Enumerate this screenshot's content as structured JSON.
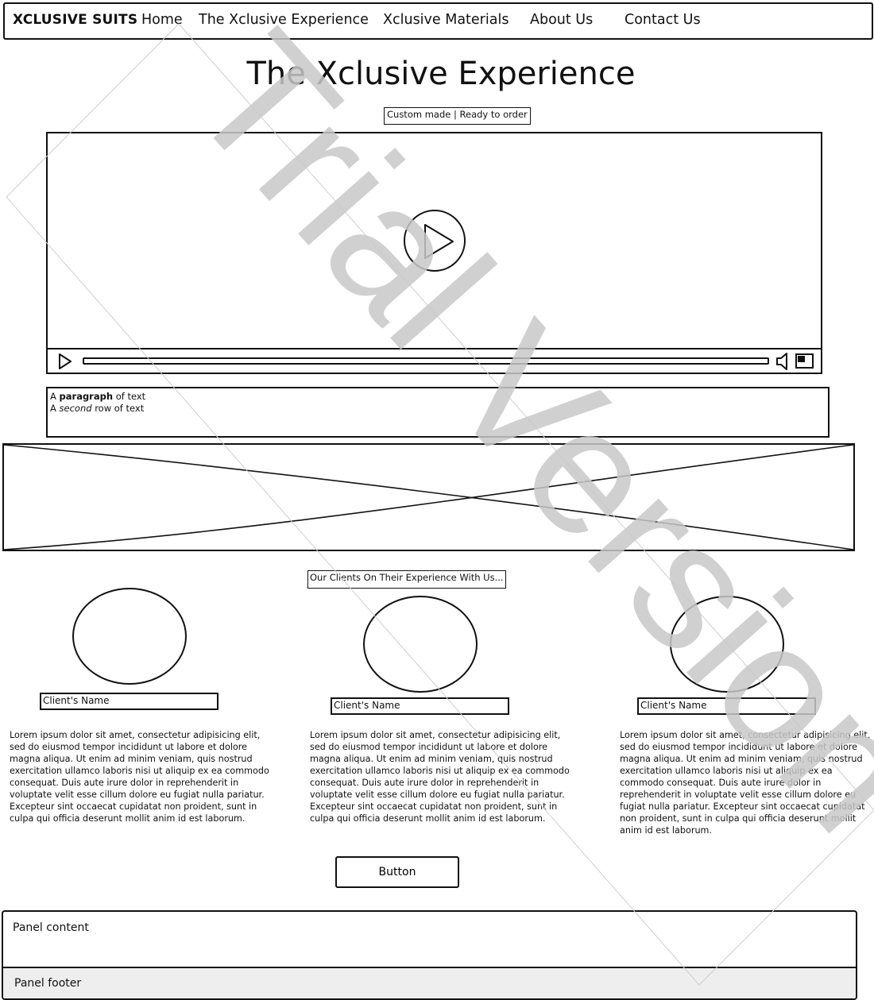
{
  "navbar": {
    "brand": "XCLUSIVE SUITS",
    "links": [
      "Home",
      "The Xclusive Experience",
      "Xclusive Materials",
      "About Us",
      "Contact Us"
    ]
  },
  "page": {
    "title": "The Xclusive Experience",
    "subtitle": "Custom made | Ready to order"
  },
  "video": {
    "play_icon": "play-icon",
    "control_icons": [
      "play-icon",
      "volume-icon",
      "fullscreen-icon"
    ]
  },
  "paragraph": {
    "line1_prefix": "A ",
    "line1_bold": "paragraph",
    "line1_suffix": " of text",
    "line2_prefix": "A ",
    "line2_italic": "second",
    "line2_suffix": " row of text"
  },
  "clients": {
    "heading": "Our Clients On Their Experience With Us...",
    "items": [
      {
        "name": "Client's Name",
        "text": "Lorem ipsum dolor sit amet, consectetur adipisicing elit, sed do eiusmod tempor incididunt ut labore et dolore magna aliqua. Ut enim ad minim veniam, quis nostrud exercitation ullamco laboris nisi ut aliquip ex ea commodo consequat. Duis aute irure dolor in reprehenderit in voluptate velit esse cillum dolore eu fugiat nulla pariatur. Excepteur sint occaecat cupidatat non proident, sunt in culpa qui officia deserunt mollit anim id est laborum."
      },
      {
        "name": "Client's Name",
        "text": "Lorem ipsum dolor sit amet, consectetur adipisicing elit, sed do eiusmod tempor incididunt ut labore et dolore magna aliqua. Ut enim ad minim veniam, quis nostrud exercitation ullamco laboris nisi ut aliquip ex ea commodo consequat. Duis aute irure dolor in reprehenderit in voluptate velit esse cillum dolore eu fugiat nulla pariatur. Excepteur sint occaecat cupidatat non proident, sunt in culpa qui officia deserunt mollit anim id est laborum."
      },
      {
        "name": "Client's Name",
        "text": "Lorem ipsum dolor sit amet, consectetur adipisicing elit, sed do eiusmod tempor incididunt ut labore et dolore magna aliqua. Ut enim ad minim veniam, quis nostrud exercitation ullamco laboris nisi ut aliquip ex ea commodo consequat. Duis aute irure dolor in reprehenderit in voluptate velit esse cillum dolore eu fugiat nulla pariatur. Excepteur sint occaecat cupidatat non proident, sunt in culpa qui officia deserunt mollit anim id est laborum."
      }
    ]
  },
  "button": {
    "label": "Button"
  },
  "panel": {
    "content": "Panel content",
    "footer": "Panel footer"
  },
  "watermark": {
    "text": "Trial Version",
    "color": "#c8c8c8"
  }
}
